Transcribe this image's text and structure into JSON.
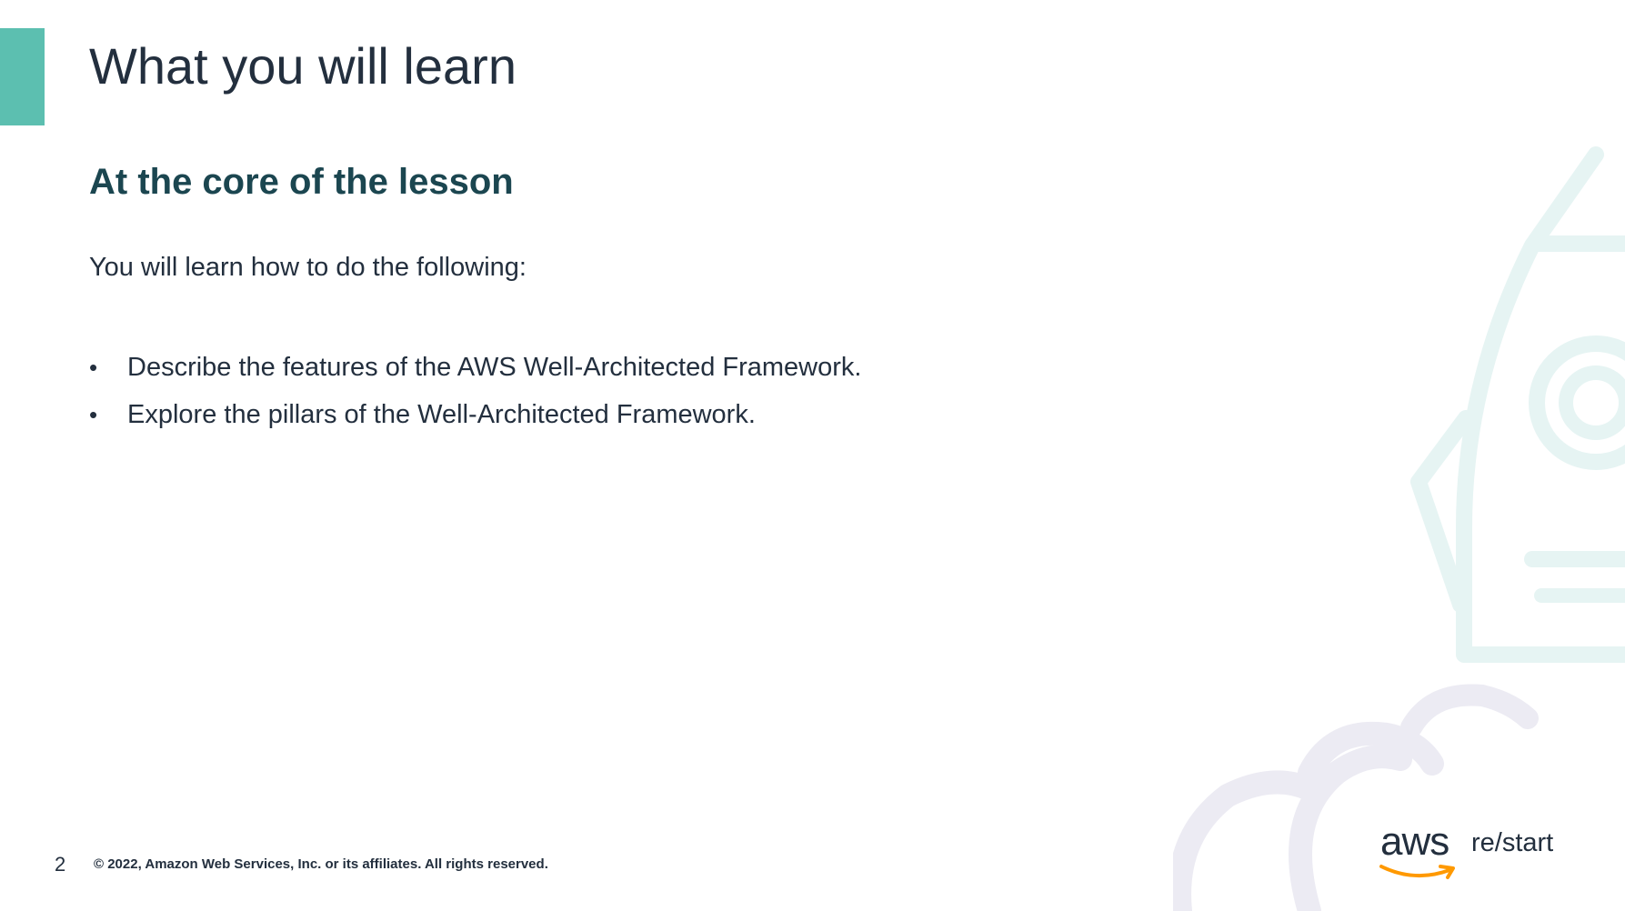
{
  "slide": {
    "title": "What you will learn",
    "subtitle": "At the core of the lesson",
    "intro": "You will learn how to do the following:",
    "bullets": [
      "Describe the features of the AWS Well-Architected Framework.",
      "Explore the pillars of the Well-Architected Framework."
    ],
    "page_number": "2",
    "copyright": "© 2022, Amazon Web Services, Inc. or its affiliates. All rights reserved."
  },
  "logo": {
    "brand": "aws",
    "product": "re/start"
  },
  "colors": {
    "accent": "#5cbfb0",
    "title": "#232f3e",
    "subtitle": "#1b4650",
    "smile": "#ff9900",
    "rocket_outline": "#e6f4f3",
    "cloud_outline": "#ecebf3"
  },
  "icons": {
    "illustration": "rocket-with-clouds-icon",
    "logo_smile": "aws-smile-arrow-icon"
  }
}
